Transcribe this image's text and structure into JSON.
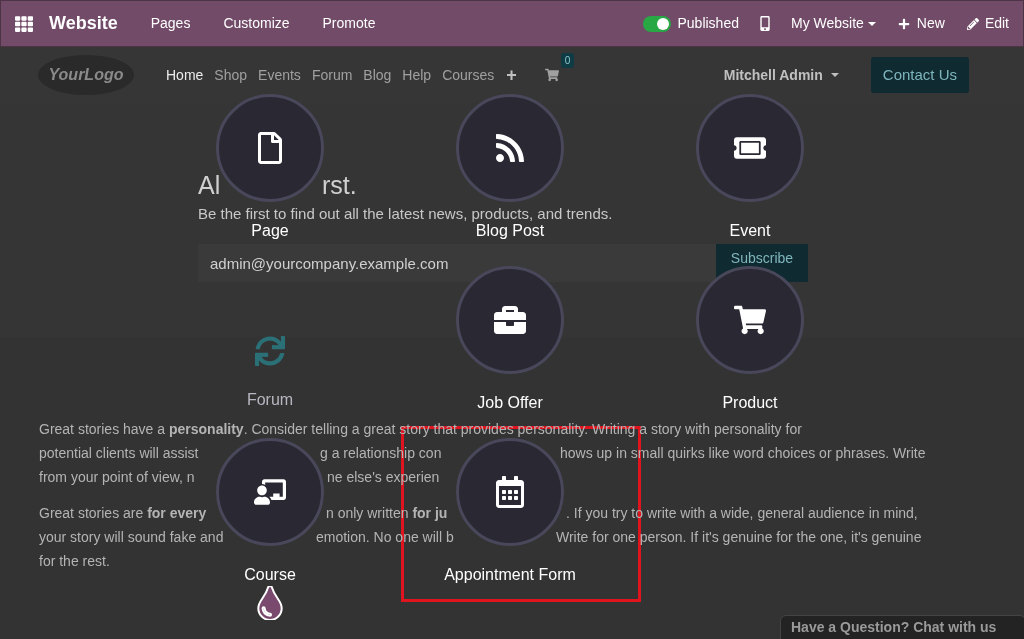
{
  "topbar": {
    "app": "Website",
    "menu": [
      "Pages",
      "Customize",
      "Promote"
    ],
    "published": {
      "label": "Published",
      "on": true
    },
    "website": "My Website",
    "new": "New",
    "edit": "Edit"
  },
  "site": {
    "logo": "YourLogo",
    "nav": [
      {
        "label": "Home",
        "selected": true
      },
      {
        "label": "Shop",
        "selected": false
      },
      {
        "label": "Events",
        "selected": false
      },
      {
        "label": "Forum",
        "selected": false
      },
      {
        "label": "Blog",
        "selected": false
      },
      {
        "label": "Help",
        "selected": false
      },
      {
        "label": "Courses",
        "selected": false
      }
    ],
    "add": "+",
    "cart_count": "0",
    "user": "Mitchell Admin",
    "contact": "Contact Us",
    "hero": {
      "title": [
        "Al",
        "rst."
      ],
      "subtitle": "Be the first to find out all the latest news, products, and trends.",
      "email": "admin@yourcompany.example.com",
      "subscribe": "Subscribe"
    },
    "paragraphs": [
      [
        [
          "Great stories have a **personality**. Consider telling a great story that provides personality. Writing a story with personality for"
        ],
        [
          "potential clients will assist",
          "g a relationship con",
          "hows up in small quirks like word choices or phrases. Write"
        ],
        [
          "from your point of view, n",
          "ne else's experien"
        ]
      ],
      [
        [
          "Great stories are **for every**",
          "n only written **for ju**",
          ". If you try to write with a wide, general audience in mind,"
        ],
        [
          "your story will sound fake and",
          "emotion. No one will b",
          "Write for one person. If it's genuine for the one, it's genuine"
        ],
        [
          "for the rest."
        ]
      ]
    ],
    "chat": "Have a Question? Chat with us"
  },
  "new_content": [
    {
      "kind": "page",
      "label": "Page",
      "highlighted": false
    },
    {
      "kind": "blog",
      "label": "Blog Post",
      "highlighted": false
    },
    {
      "kind": "event",
      "label": "Event",
      "highlighted": false
    },
    {
      "kind": "loading",
      "label": "Forum",
      "highlighted": false
    },
    {
      "kind": "job",
      "label": "Job Offer",
      "highlighted": false
    },
    {
      "kind": "product",
      "label": "Product",
      "highlighted": false
    },
    {
      "kind": "course",
      "label": "Course",
      "highlighted": false
    },
    {
      "kind": "appointment",
      "label": "Appointment Form",
      "highlighted": true
    },
    {
      "kind": "installing",
      "highlighted": false
    }
  ]
}
